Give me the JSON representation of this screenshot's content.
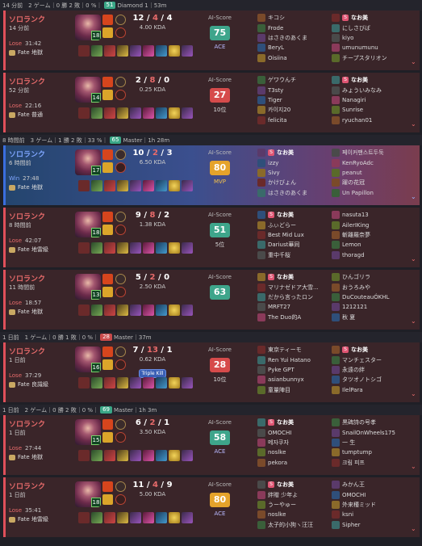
{
  "sessions": [
    {
      "text": "14 分前　2 ゲーム｜0 勝 2 敗｜0 %｜",
      "score": "51",
      "score_color": "green",
      "rank_text": "Diamond 1｜53m"
    },
    {
      "text": "8 時間前　3 ゲーム｜1 勝 2 敗｜33 %｜",
      "score": "65",
      "score_color": "green",
      "rank_text": "Master｜1h 28m"
    },
    {
      "text": "1 日前　1 ゲーム｜0 勝 1 敗｜0 %｜",
      "score": "28",
      "score_color": "red",
      "rank_text": "Master｜37m"
    },
    {
      "text": "1 日前　2 ゲーム｜0 勝 2 敗｜0 %｜",
      "score": "69",
      "score_color": "green",
      "rank_text": "Master｜1h 3m"
    }
  ],
  "matches": [
    {
      "queue": "ソロランク",
      "ago": "14 分前",
      "result": "Lose",
      "duration": "31:42",
      "rank": "Fate 地獄",
      "k": "12",
      "d": "4",
      "a": "4",
      "kda": "4.00 KDA",
      "ai_label": "AI-Score",
      "ai": "75",
      "ai_color": "g",
      "tag": "ACE",
      "level": "18",
      "multi": "",
      "team1": [
        "キコシ",
        "Frode",
        "はさきのあくま",
        "BeryL",
        "Oisiina"
      ],
      "team2": [
        "なお美",
        "にしさびば",
        "kiyo",
        "umunumunu",
        "チープスタリオン"
      ]
    },
    {
      "queue": "ソロランク",
      "ago": "52 分前",
      "result": "Lose",
      "duration": "22:16",
      "rank": "Fate 普通",
      "k": "2",
      "d": "8",
      "a": "0",
      "kda": "0.25 KDA",
      "ai_label": "AI-Score",
      "ai": "27",
      "ai_color": "r",
      "tag": "10位",
      "level": "14",
      "multi": "",
      "team1": [
        "ゲワウんチ",
        "T3sty",
        "Tiger",
        "카이지20",
        "felicita"
      ],
      "team2": [
        "なお美",
        "みょういみなみ",
        "Nanagiri",
        "Sunrise",
        "ryuchan01"
      ]
    },
    {
      "queue": "ソロランク",
      "ago": "6 時間前",
      "result": "Win",
      "duration": "27:48",
      "rank": "Fate 地獄",
      "k": "10",
      "d": "2",
      "a": "3",
      "kda": "6.50 KDA",
      "ai_label": "AI-Score",
      "ai": "80",
      "ai_color": "y",
      "tag": "MVP",
      "level": "17",
      "multi": "",
      "team1": [
        "なお美",
        "izzy",
        "Sivy",
        "かけびょん",
        "はさきのあくま"
      ],
      "team2": [
        "페이커팬스트두둑",
        "KenRyoAdc",
        "peanut",
        "躍の花冠",
        "Un Papillon"
      ]
    },
    {
      "queue": "ソロランク",
      "ago": "8 時間前",
      "result": "Lose",
      "duration": "42:07",
      "rank": "Fate 地雷級",
      "k": "9",
      "d": "8",
      "a": "2",
      "kda": "1.38 KDA",
      "ai_label": "AI-Score",
      "ai": "51",
      "ai_color": "g",
      "tag": "5位",
      "level": "18",
      "multi": "",
      "team1": [
        "なお美",
        "ふぃどらー",
        "Best Mid Lux",
        "Dariust華同",
        "重中千桜"
      ],
      "team2": [
        "nasuta13",
        "AilerIKing",
        "斬離羅奈夢",
        "Lemon",
        "thoragd"
      ]
    },
    {
      "queue": "ソロランク",
      "ago": "11 時間前",
      "result": "Lose",
      "duration": "18:57",
      "rank": "Fate 地獄",
      "k": "5",
      "d": "2",
      "a": "0",
      "kda": "2.50 KDA",
      "ai_label": "AI-Score",
      "ai": "63",
      "ai_color": "g",
      "tag": "",
      "level": "13",
      "multi": "",
      "team1": [
        "なお美",
        "マリナゼドア大雪...",
        "だから言ったロン",
        "MRFT27",
        "The Duo的A"
      ],
      "team2": [
        "ひんゴリラ",
        "おうろみや",
        "DuCouteauÓKHL",
        "1212121",
        "秋 夏"
      ]
    },
    {
      "queue": "ソロランク",
      "ago": "1 日前",
      "result": "Lose",
      "duration": "37:29",
      "rank": "Fate 良識級",
      "k": "7",
      "d": "13",
      "a": "1",
      "kda": "0.62 KDA",
      "ai_label": "AI-Score",
      "ai": "28",
      "ai_color": "r",
      "tag": "10位",
      "level": "16",
      "multi": "Triple Kill",
      "team1": [
        "東京ティーモ",
        "Ren Yui Hatano",
        "Pyke GPT",
        "asianbunnyx",
        "童量陣目"
      ],
      "team2": [
        "なお美",
        "マンチェスター",
        "永遠の絆",
        "タツオノトシゴ",
        "IlelPara"
      ]
    },
    {
      "queue": "ソロランク",
      "ago": "1 日前",
      "result": "Lose",
      "duration": "27:44",
      "rank": "Fate 地獄",
      "k": "6",
      "d": "2",
      "a": "1",
      "kda": "3.50 KDA",
      "ai_label": "AI-Score",
      "ai": "58",
      "ai_color": "g",
      "tag": "ACE",
      "level": "15",
      "multi": "",
      "team1": [
        "なお美",
        "OMOCHI",
        "메자쿠자",
        "noslke",
        "pekora"
      ],
      "team2": [
        "黒碑詩の号孝",
        "SnailOnWheels175",
        "一 生",
        "tumptump",
        "크림 피프"
      ]
    },
    {
      "queue": "ソロランク",
      "ago": "1 日前",
      "result": "Lose",
      "duration": "35:41",
      "rank": "Fate 地雷級",
      "k": "11",
      "d": "4",
      "a": "9",
      "kda": "5.00 KDA",
      "ai_label": "AI-Score",
      "ai": "80",
      "ai_color": "y",
      "tag": "ACE",
      "level": "18",
      "multi": "",
      "team1": [
        "なお美",
        "絆贈 少年よ",
        "うーやゅー",
        "noslke",
        "太子的小狗ヽ汪汪"
      ],
      "team2": [
        "みかん王",
        "OMOCHI",
        "外来種ミッド",
        "ksni",
        "Sipher"
      ]
    }
  ]
}
